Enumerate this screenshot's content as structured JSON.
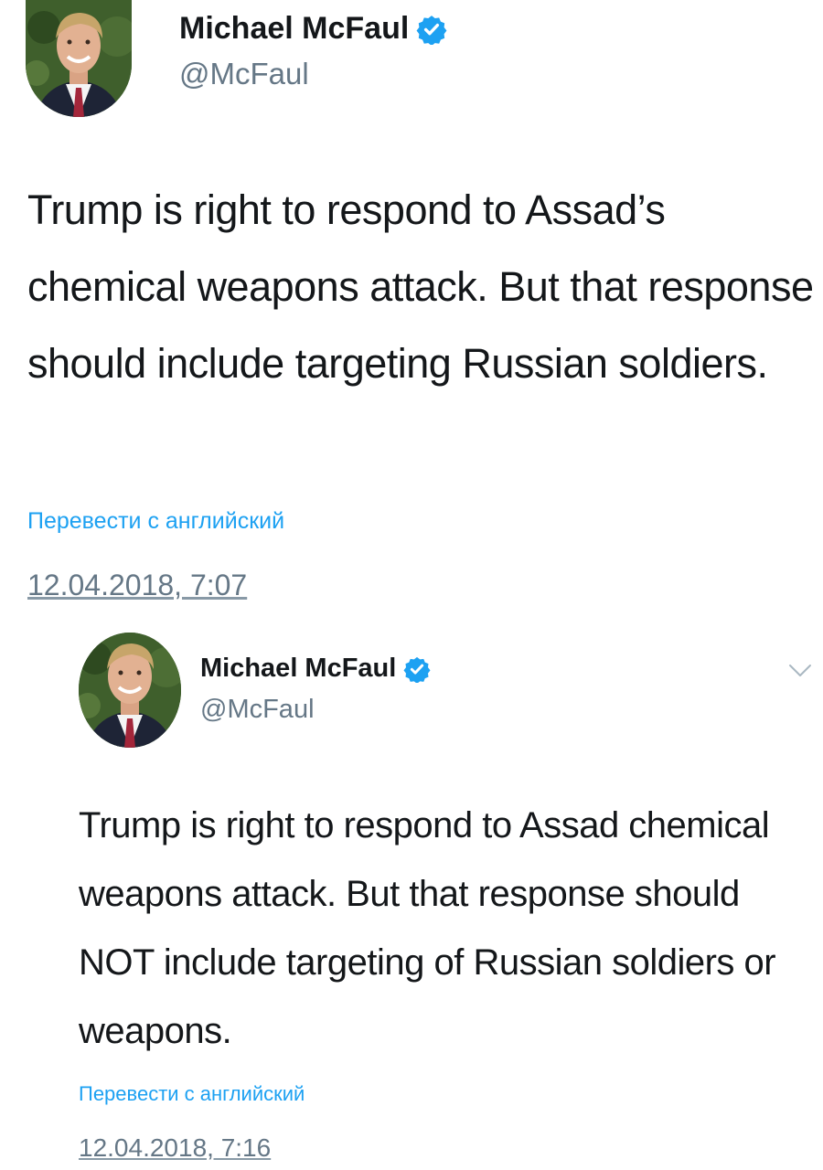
{
  "tweets": [
    {
      "author": {
        "name": "Michael McFaul",
        "handle": "@McFaul",
        "verified": true
      },
      "text": "Trump is right to respond to Assad’s chemical weapons attack. But that response should include targeting Russian soldiers.",
      "translate_label": "Перевести с английский",
      "timestamp": "12.04.2018, 7:07"
    },
    {
      "author": {
        "name": "Michael McFaul",
        "handle": "@McFaul",
        "verified": true
      },
      "text": "Trump is right to respond to Assad chemical weapons attack. But that response should NOT include targeting of Russian soldiers or weapons.",
      "translate_label": "Перевести с английский",
      "timestamp": "12.04.2018, 7:16",
      "menu_icon": "chevron-down-icon"
    }
  ],
  "colors": {
    "link": "#1da1f2",
    "verified_badge": "#1da1f2",
    "secondary_text": "#657786",
    "primary_text": "#14171a"
  }
}
